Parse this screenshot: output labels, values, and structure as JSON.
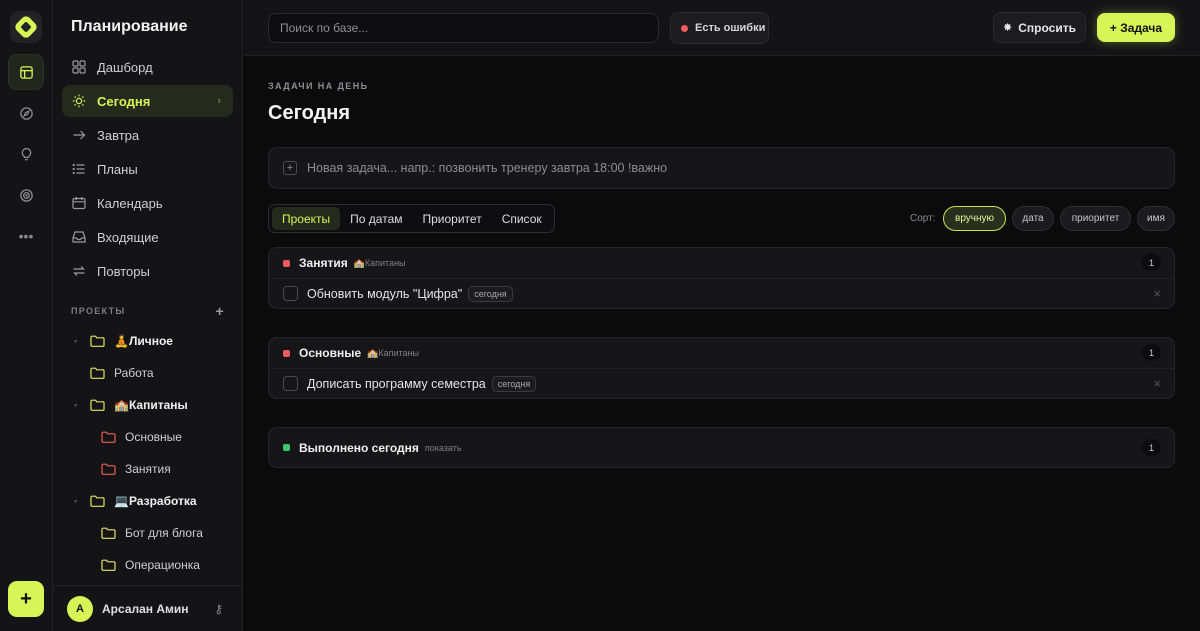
{
  "sidebar": {
    "title": "Планирование",
    "nav": [
      {
        "label": "Дашборд",
        "icon": "grid-icon"
      },
      {
        "label": "Сегодня",
        "icon": "sun-icon",
        "active": true
      },
      {
        "label": "Завтра",
        "icon": "arrow-right-icon"
      },
      {
        "label": "Планы",
        "icon": "list-icon"
      },
      {
        "label": "Календарь",
        "icon": "calendar-icon"
      },
      {
        "label": "Входящие",
        "icon": "inbox-icon"
      },
      {
        "label": "Повторы",
        "icon": "repeat-icon"
      }
    ],
    "projects_header": "ПРОЕКТЫ",
    "projects_add": "+",
    "projects": [
      {
        "label": "🧘Личное",
        "level": 0,
        "color": "#e8e36a"
      },
      {
        "label": "Работа",
        "level": 1,
        "color": "#e8e36a"
      },
      {
        "label": "🏫Капитаны",
        "level": 0,
        "color": "#e8e36a"
      },
      {
        "label": "Основные",
        "level": 2,
        "color": "#ef5a5a"
      },
      {
        "label": "Занятия",
        "level": 2,
        "color": "#ef5a5a"
      },
      {
        "label": "💻Разработка",
        "level": 0,
        "color": "#e8e36a"
      },
      {
        "label": "Бот для блога",
        "level": 1,
        "color": "#e8e36a"
      },
      {
        "label": "Операционка",
        "level": 1,
        "color": "#e8e36a"
      }
    ],
    "user": {
      "initial": "А",
      "name": "Арсалан Амин"
    }
  },
  "topbar": {
    "search_placeholder": "Поиск по базе...",
    "errors_label": "Есть ошибки",
    "ask_label": "Спросить",
    "task_label": "+ Задача"
  },
  "main": {
    "eyebrow": "ЗАДАЧИ НА ДЕНЬ",
    "title": "Сегодня",
    "new_task_placeholder": "Новая задача... напр.: позвонить тренеру завтра 18:00 !важно",
    "tabs": [
      "Проекты",
      "По датам",
      "Приоритет",
      "Список"
    ],
    "active_tab": 0,
    "sort_label": "Сорт:",
    "sort_options": [
      "вручную",
      "дата",
      "приоритет",
      "имя"
    ],
    "active_sort": 0,
    "groups": [
      {
        "name": "Занятия",
        "sub": "🏫Капитаны",
        "count": "1",
        "color": "#ef5a5a",
        "tasks": [
          {
            "text": "Обновить модуль \"Цифра\"",
            "badge": "сегодня"
          }
        ]
      },
      {
        "name": "Основные",
        "sub": "🏫Капитаны",
        "count": "1",
        "color": "#ef5a5a",
        "tasks": [
          {
            "text": "Дописать программу семестра",
            "badge": "сегодня"
          }
        ]
      },
      {
        "name": "Выполнено сегодня",
        "sub": "показать",
        "count": "1",
        "color": "#3ec86b",
        "tasks": []
      }
    ]
  },
  "colors": {
    "accent": "#d7f556",
    "error": "#f25c5c",
    "done": "#3ec86b"
  }
}
